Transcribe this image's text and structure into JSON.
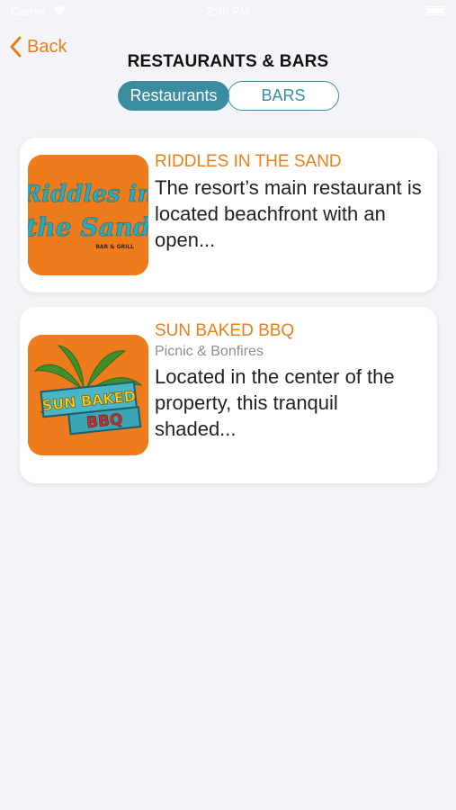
{
  "status_bar": {
    "carrier": "Carrier",
    "time": "2:48 PM"
  },
  "nav": {
    "back_label": "Back",
    "title": "RESTAURANTS & BARS"
  },
  "tabs": [
    {
      "label": "Restaurants",
      "selected": true
    },
    {
      "label": "BARS",
      "selected": false
    }
  ],
  "colors": {
    "accent_orange": "#e8801a",
    "teal": "#3a8c9e"
  },
  "cards": [
    {
      "title": "RIDDLES IN THE SAND",
      "subtitle": "",
      "description": "The resort’s main restaurant is located beachfront with an open...",
      "logo": {
        "line1": "Riddles in",
        "line2": "the Sand",
        "tag": "BAR & GRILL"
      }
    },
    {
      "title": "SUN BAKED BBQ",
      "subtitle": "Picnic & Bonfires",
      "description": "Located in the center of the property, this tranquil shaded...",
      "logo": {
        "line1": "SUN BAKED",
        "line2": "BBQ"
      }
    }
  ]
}
